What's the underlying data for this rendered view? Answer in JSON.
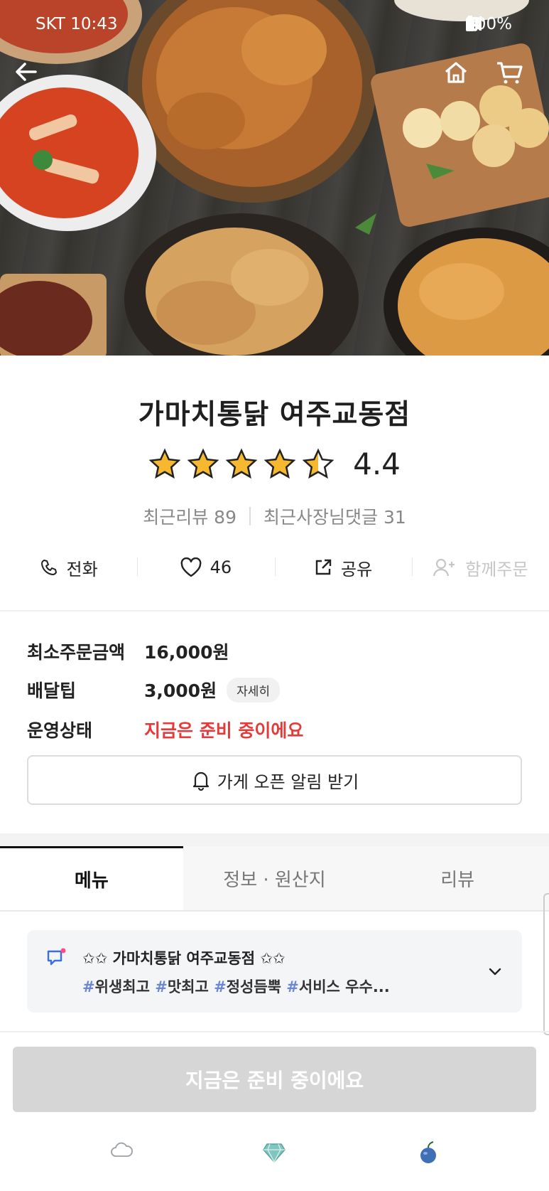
{
  "status_bar": {
    "carrier_time": "SKT 10:43",
    "battery": "100%"
  },
  "header": {
    "back_icon": "arrow-left-icon",
    "home_icon": "home-icon",
    "cart_icon": "cart-icon"
  },
  "store": {
    "name": "가마치통닭 여주교동점",
    "rating": "4.4",
    "rating_fraction": 0.88,
    "recent_reviews": "최근리뷰 89",
    "owner_replies": "최근사장님댓글 31"
  },
  "actions": {
    "call": "전화",
    "likes": "46",
    "share": "공유",
    "group_order": "함께주문"
  },
  "info": {
    "min_order_label": "최소주문금액",
    "min_order_value": "16,000원",
    "delivery_tip_label": "배달팁",
    "delivery_tip_value": "3,000원",
    "detail_badge": "자세히",
    "status_label": "운영상태",
    "status_value": "지금은 준비 중이에요",
    "alert_button": "가게 오픈 알림 받기"
  },
  "tabs": [
    {
      "label": "메뉴",
      "active": true
    },
    {
      "label": "정보 · 원산지",
      "active": false
    },
    {
      "label": "리뷰",
      "active": false
    }
  ],
  "notice": {
    "title": "✩✩ 가마치통닭 여주교동점 ✩✩",
    "tag1": "#",
    "text1": "위생최고 ",
    "tag2": "#",
    "text2": "맛최고 ",
    "tag3": "#",
    "text3": "정성듬뿍 ",
    "tag4": "#",
    "text4": "서비스 우수..."
  },
  "order_button": "지금은 준비 중이에요",
  "colors": {
    "accent_red": "#e53a3a",
    "star_yellow": "#f5b82e",
    "disabled_gray": "#d6d6d6",
    "hashtag_blue": "#6b86d4"
  }
}
